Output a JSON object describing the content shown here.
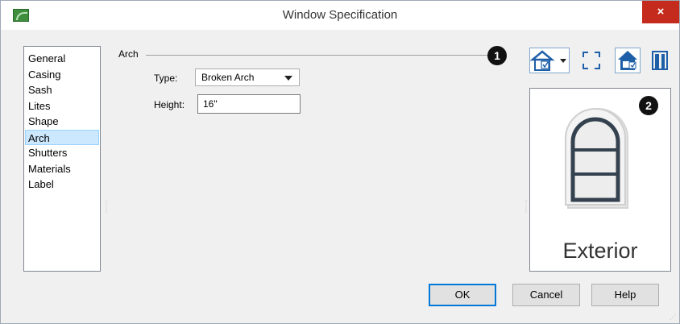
{
  "window": {
    "title": "Window Specification",
    "close_glyph": "×",
    "app_icon": "app-icon"
  },
  "nav": {
    "items": [
      {
        "label": "General",
        "selected": false
      },
      {
        "label": "Casing",
        "selected": false
      },
      {
        "label": "Sash",
        "selected": false
      },
      {
        "label": "Lites",
        "selected": false
      },
      {
        "label": "Shape",
        "selected": false
      },
      {
        "label": "Arch",
        "selected": true
      },
      {
        "label": "Shutters",
        "selected": false
      },
      {
        "label": "Materials",
        "selected": false
      },
      {
        "label": "Label",
        "selected": false
      }
    ]
  },
  "arch": {
    "group_label": "Arch",
    "type_label": "Type:",
    "type_value": "Broken Arch",
    "height_label": "Height:",
    "height_value": "16\""
  },
  "markers": {
    "one": "1",
    "two": "2"
  },
  "preview": {
    "caption": "Exterior",
    "tools": [
      "view-options-dropdown-icon",
      "fill-window-icon",
      "color-view-icon",
      "camera-view-icon"
    ]
  },
  "buttons": {
    "ok": "OK",
    "cancel": "Cancel",
    "help": "Help"
  },
  "colors": {
    "selection": "#cce8ff",
    "close": "#c42b1c",
    "default_button_border": "#0078d7"
  }
}
